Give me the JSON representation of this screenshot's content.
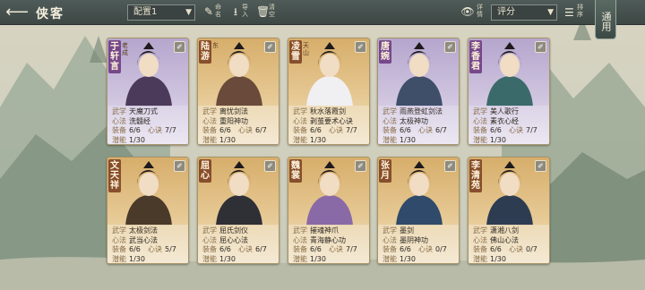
{
  "header": {
    "title": "侠客",
    "back_icon": "back-arrow-icon"
  },
  "toolbar": {
    "config_select": "配置1",
    "btn_naming": "命名",
    "btn_import": "导入",
    "btn_clear": "清空",
    "btn_detail": "详情",
    "sort_select": "评分",
    "btn_sort": "排序",
    "right_tab": "通用"
  },
  "colors": {
    "purple_tier": "#b5a6cd",
    "gold_tier": "#d7ae6b"
  },
  "labels": {
    "wuxue": "武学",
    "xinfa": "心法",
    "zhuangbei": "装备",
    "xinjue": "心诀",
    "qianneng": "潜能"
  },
  "cards": [
    {
      "name": "于轩言",
      "sect": "老成",
      "tier": "purple",
      "wuxue": "天魔刀式",
      "xinfa": "洗髓经",
      "equip": "6/6",
      "xinjue": "7/7",
      "potential": "1/30"
    },
    {
      "name": "陆游",
      "sect": "东",
      "tier": "gold",
      "wuxue": "离忧剑法",
      "xinfa": "重阳神功",
      "equip": "6/6",
      "xinjue": "6/7",
      "potential": "1/30"
    },
    {
      "name": "凌雪",
      "sect": "天山",
      "tier": "gold",
      "wuxue": "秋水落霞剑",
      "xinfa": "剥茧要术心诀",
      "equip": "6/6",
      "xinjue": "7/7",
      "potential": "1/30"
    },
    {
      "name": "唐婉",
      "sect": "",
      "tier": "purple",
      "wuxue": "雨燕登虹剑法",
      "xinfa": "太极神功",
      "equip": "6/6",
      "xinjue": "6/7",
      "potential": "1/30"
    },
    {
      "name": "李香君",
      "sect": "",
      "tier": "purple",
      "wuxue": "美人歌行",
      "xinfa": "素衣心经",
      "equip": "6/6",
      "xinjue": "7/7",
      "potential": "1/30"
    },
    {
      "name": "文天祥",
      "sect": "",
      "tier": "gold",
      "wuxue": "太极剑法",
      "xinfa": "武当心法",
      "equip": "6/6",
      "xinjue": "5/7",
      "potential": "1/30"
    },
    {
      "name": "屈心",
      "sect": "",
      "tier": "gold",
      "wuxue": "屈氏剑仪",
      "xinfa": "屈心心法",
      "equip": "6/6",
      "xinjue": "6/7",
      "potential": "1/30"
    },
    {
      "name": "魏裳",
      "sect": "",
      "tier": "gold",
      "wuxue": "摧魂神爪",
      "xinfa": "青海静心功",
      "equip": "6/6",
      "xinjue": "7/7",
      "potential": "1/30"
    },
    {
      "name": "张月",
      "sect": "",
      "tier": "gold",
      "wuxue": "墨剑",
      "xinfa": "墨阴神功",
      "equip": "6/6",
      "xinjue": "0/7",
      "potential": "1/30"
    },
    {
      "name": "李清苑",
      "sect": "",
      "tier": "gold",
      "wuxue": "潇湘八剑",
      "xinfa": "佛山心法",
      "equip": "6/6",
      "xinjue": "0/7",
      "potential": "1/30"
    }
  ]
}
